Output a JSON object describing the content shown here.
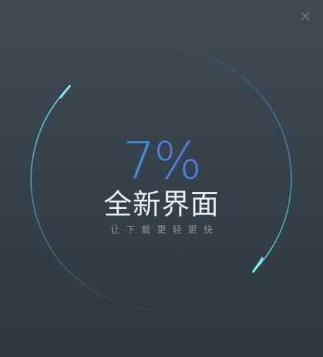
{
  "window": {
    "close_icon": "close-icon"
  },
  "progress": {
    "percent_value": 7,
    "percent_number": "7",
    "percent_sign": "%"
  },
  "headline": {
    "title": "全新界面",
    "subtitle": "让下载更轻更快"
  },
  "colors": {
    "background_top": "#3e4a54",
    "background_bottom": "#2f3840",
    "ring_accent": "#5fe3f2",
    "ring_faint": "#3fa9c6",
    "percent_text": "#3f8ed9",
    "title_text": "#e9eef2",
    "subtitle_text": "#8b96a0"
  }
}
